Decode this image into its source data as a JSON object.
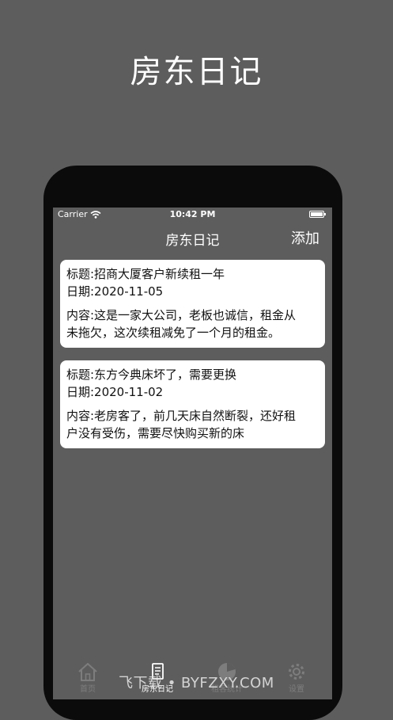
{
  "promo": {
    "title": "房东日记"
  },
  "status_bar": {
    "carrier": "Carrier",
    "time": "10:42 PM"
  },
  "nav": {
    "title": "房东日记",
    "add_label": "添加"
  },
  "entries": [
    {
      "title_line": "标题:招商大厦客户新续租一年",
      "date_line": "日期:2020-11-05",
      "content_line1": "内容:这是一家大公司，老板也诚信，租金从",
      "content_line2": "未拖欠，这次续租减免了一个月的租金。"
    },
    {
      "title_line": "标题:东方今典床坏了，需要更换",
      "date_line": "日期:2020-11-02",
      "content_line1": "内容:老房客了，前几天床自然断裂，还好租",
      "content_line2": "户没有受伤，需要尽快购买新的床"
    }
  ],
  "tabs": [
    {
      "label": "首页",
      "icon": "home-icon"
    },
    {
      "label": "房东日记",
      "icon": "diary-icon",
      "active": true
    },
    {
      "label": "租客统计",
      "icon": "chart-icon"
    },
    {
      "label": "设置",
      "icon": "gear-icon"
    }
  ],
  "watermark": {
    "text": "飞下载 • BYFZXY.COM"
  }
}
